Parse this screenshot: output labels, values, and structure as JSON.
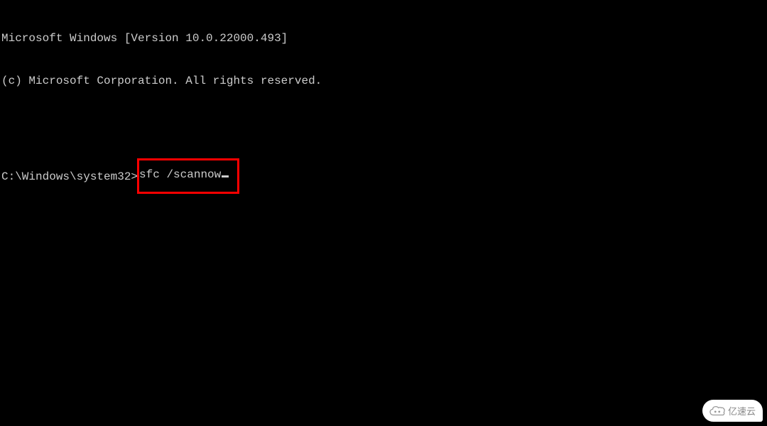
{
  "terminal": {
    "header_line1": "Microsoft Windows [Version 10.0.22000.493]",
    "header_line2": "(c) Microsoft Corporation. All rights reserved.",
    "prompt": "C:\\Windows\\system32>",
    "command": "sfc /scannow"
  },
  "watermark": {
    "text": "亿速云"
  },
  "highlight": {
    "border_color": "#ff0000"
  }
}
